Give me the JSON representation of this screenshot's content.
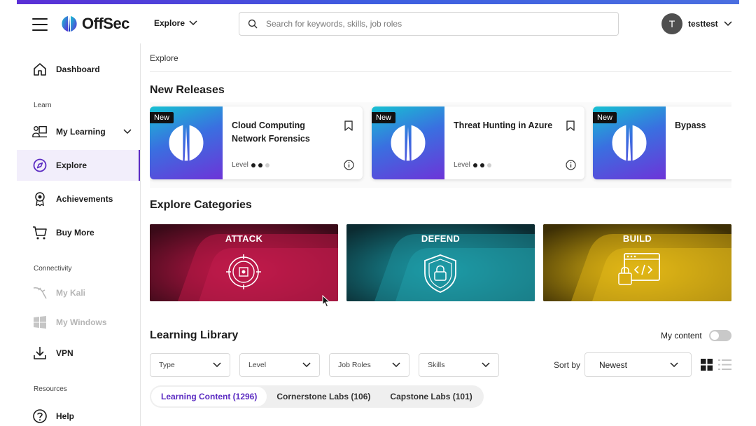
{
  "header": {
    "logo_text": "OffSec",
    "explore_label": "Explore",
    "search_placeholder": "Search for keywords, skills, job roles",
    "avatar_letter": "T",
    "username": "testtest"
  },
  "sidebar": {
    "items": [
      {
        "label": "Dashboard",
        "icon": "home-icon"
      },
      {
        "label": "My Learning",
        "icon": "learning-icon"
      },
      {
        "label": "Explore",
        "icon": "compass-icon"
      },
      {
        "label": "Achievements",
        "icon": "medal-icon"
      },
      {
        "label": "Buy More",
        "icon": "cart-icon"
      },
      {
        "label": "My Kali",
        "icon": "kali-icon"
      },
      {
        "label": "My Windows",
        "icon": "windows-icon"
      },
      {
        "label": "VPN",
        "icon": "download-icon"
      },
      {
        "label": "Help",
        "icon": "help-icon"
      }
    ],
    "sections": {
      "learn": "Learn",
      "connectivity": "Connectivity",
      "resources": "Resources"
    }
  },
  "main": {
    "breadcrumb": "Explore",
    "new_releases_title": "New Releases",
    "releases": [
      {
        "badge": "New",
        "title": "Cloud Computing Network Forensics",
        "level_label": "Level"
      },
      {
        "badge": "New",
        "title": "Threat Hunting in Azure",
        "level_label": "Level"
      },
      {
        "badge": "New",
        "title": "Bypass"
      }
    ],
    "categories_title": "Explore Categories",
    "categories": [
      {
        "label": "ATTACK",
        "color": "#b0143f"
      },
      {
        "label": "DEFEND",
        "color": "#1a8a95"
      },
      {
        "label": "BUILD",
        "color": "#d6a90f"
      }
    ],
    "library_title": "Learning Library",
    "my_content_label": "My content",
    "filters": [
      "Type",
      "Level",
      "Job Roles",
      "Skills"
    ],
    "sort_label": "Sort by",
    "sort_value": "Newest",
    "tabs": [
      "Learning Content (1296)",
      "Cornerstone Labs (106)",
      "Capstone Labs (101)"
    ]
  },
  "colors": {
    "accent": "#5b2bc2",
    "active_bg": "#f2eefb"
  }
}
